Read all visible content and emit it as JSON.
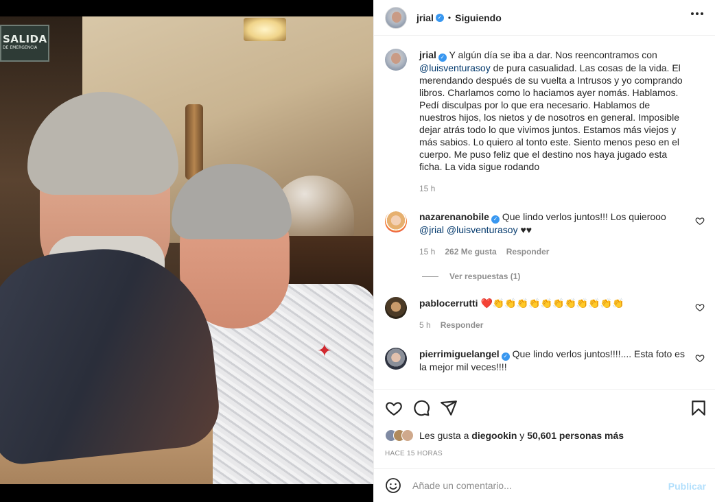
{
  "post": {
    "username": "jrial",
    "verified_mark": "✓",
    "separator": "•",
    "follow_status": "Siguiendo",
    "photo": {
      "exit_sign_text": "SALIDA",
      "exit_sign_sub": "DE EMERGENCIA"
    }
  },
  "caption": {
    "username": "jrial",
    "text_1": "Y algún día se iba a dar. Nos reencontramos con",
    "mention": "@luisventurasoy",
    "text_2": "de pura casualidad. Las cosas de la vida. El merendando después de su vuelta a Intrusos y yo comprando libros. Charlamos como lo haciamos ayer nomás. Hablamos. Pedí disculpas por lo que era necesario. Hablamos de nuestros hijos, los nietos y de nosotros en general. Imposible dejar atrás todo lo que vivimos juntos. Estamos más viejos y más sabios. Lo quiero al tonto este. Siento menos peso en el cuerpo. Me puso feliz que el destino nos haya jugado esta ficha. La vida sigue rodando",
    "time": "15 h"
  },
  "comments": [
    {
      "username": "nazarenanobile",
      "text_1": "Que lindo verlos juntos!!! Los quierooo",
      "mention_1": "@jrial",
      "mention_2": "@luisventurasoy",
      "text_2": "♥♥",
      "time": "15 h",
      "likes": "262 Me gusta",
      "reply": "Responder",
      "view_replies": "Ver respuestas (1)"
    },
    {
      "username": "pablocerrutti",
      "text": "❤️👏👏👏👏👏👏👏👏👏👏👏",
      "time": "5 h",
      "reply": "Responder"
    },
    {
      "username": "pierrimiguelangel",
      "text": "Que lindo verlos juntos!!!!.... Esta foto es la mejor mil veces!!!!"
    }
  ],
  "likes": {
    "prefix": "Les gusta a",
    "user": "diegookin",
    "conj": "y",
    "count": "50,601 personas más"
  },
  "timeago": "HACE 15 HORAS",
  "add_comment": {
    "placeholder": "Añade un comentario...",
    "publish": "Publicar"
  },
  "colors": {
    "verified": "#3897f0",
    "mention": "#00376b",
    "muted": "#8e8e8e",
    "publish_disabled": "#b2dffc",
    "heart": "#ed4956"
  },
  "icons": [
    "more-icon",
    "heart-icon",
    "comment-icon",
    "share-icon",
    "bookmark-icon",
    "emoji-icon"
  ]
}
